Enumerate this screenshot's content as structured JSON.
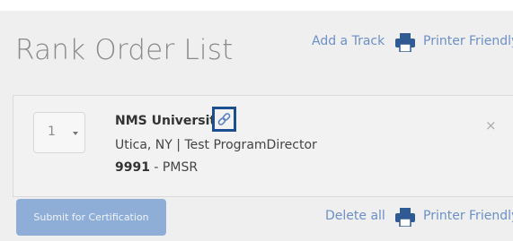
{
  "header": {
    "title": "Rank Order List",
    "add_track_label": "Add a Track",
    "printer_friendly_label": "Printer Friendly"
  },
  "program": {
    "rank": "1",
    "name": "NMS University",
    "location": "Utica, NY | Test ProgramDirector",
    "code_number": "9991",
    "code_suffix": " - PMSR",
    "remove_symbol": "×"
  },
  "footer": {
    "submit_label": "Submit for Certification",
    "delete_all_label": "Delete all",
    "printer_friendly_label": "Printer Friendly"
  },
  "icons": {
    "printer": "printer-icon",
    "link": "link-icon",
    "rank_caret": "chevron-down-icon"
  },
  "colors": {
    "link": "#6c8fc7",
    "submit_button": "#8faed7",
    "highlight_box": "#1b4f91"
  }
}
